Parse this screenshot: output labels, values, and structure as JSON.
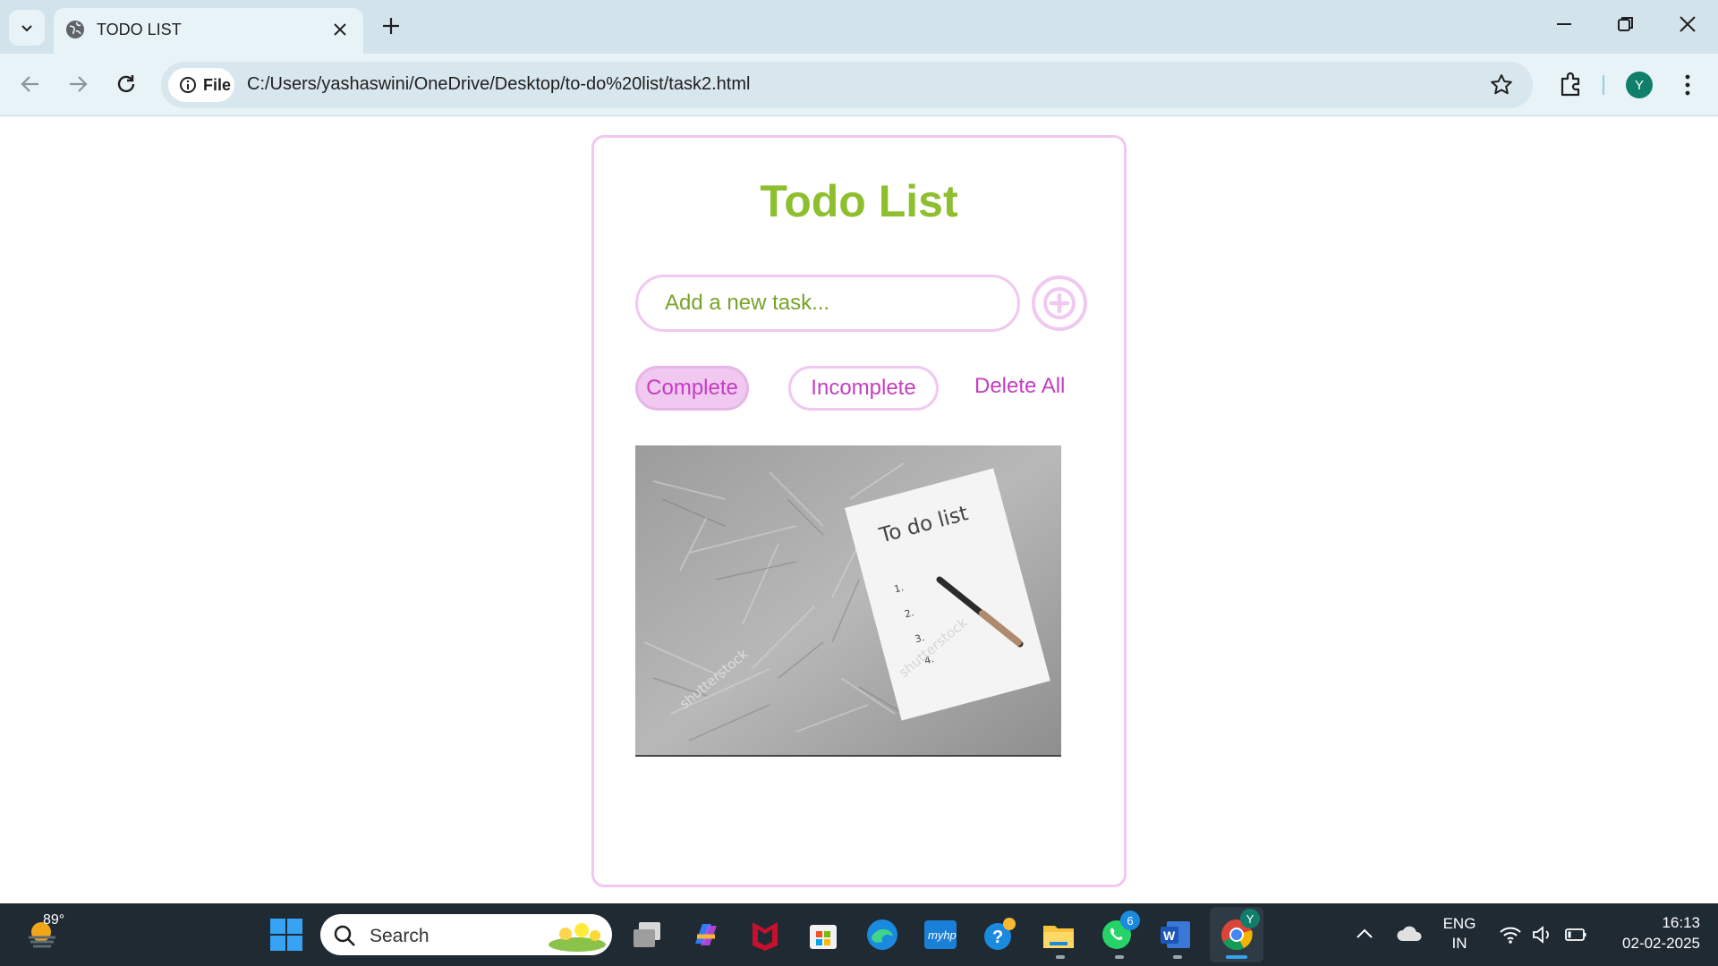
{
  "browser": {
    "tab_title": "TODO LIST",
    "site_chip_label": "File",
    "url": "C:/Users/yashaswini/OneDrive/Desktop/to-do%20list/task2.html",
    "profile_initial": "Y"
  },
  "app": {
    "title": "Todo List",
    "input_placeholder": "Add a new task...",
    "filters": [
      {
        "label": "Complete",
        "active": true
      },
      {
        "label": "Incomplete",
        "active": false
      }
    ],
    "delete_all_label": "Delete All",
    "image_text": {
      "heading": "To do list",
      "items": [
        "1.",
        "2.",
        "3.",
        "4."
      ],
      "watermark": "shutterstock"
    },
    "colors": {
      "title_green": "#8dbf2e",
      "accent_pink": "#f0c8f0",
      "button_text_magenta": "#c53dc0"
    }
  },
  "taskbar": {
    "weather_temp": "89°",
    "search_label": "Search",
    "whatsapp_badge": "6",
    "chrome_badge": "Y",
    "language_line1": "ENG",
    "language_line2": "IN",
    "time": "16:13",
    "date": "02-02-2025",
    "icons": [
      "windows-start-icon",
      "search-icon",
      "task-view-icon",
      "copilot-icon",
      "mcafee-icon",
      "microsoft-store-icon",
      "edge-icon",
      "myhp-icon",
      "get-help-icon",
      "file-explorer-icon",
      "whatsapp-icon",
      "word-icon",
      "chrome-icon"
    ]
  }
}
